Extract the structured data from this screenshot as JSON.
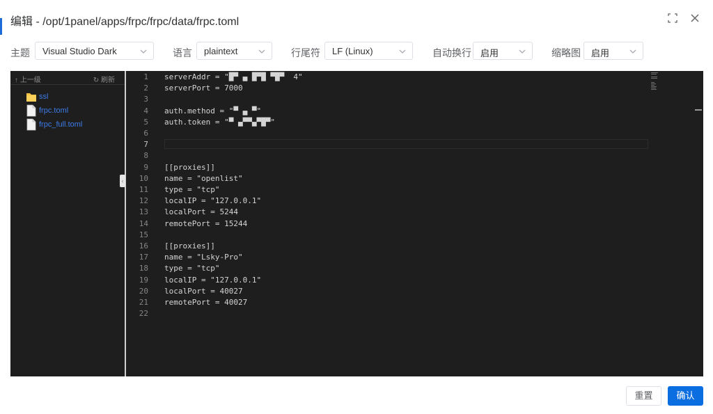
{
  "dialog": {
    "title": "编辑 - /opt/1panel/apps/frpc/frpc/data/frpc.toml"
  },
  "toolbar": {
    "theme": {
      "label": "主题",
      "value": "Visual Studio Dark"
    },
    "language": {
      "label": "语言",
      "value": "plaintext"
    },
    "eol": {
      "label": "行尾符",
      "value": "LF (Linux)"
    },
    "wrap": {
      "label": "自动换行",
      "value": "启用"
    },
    "minimap": {
      "label": "缩略图",
      "value": "启用"
    }
  },
  "filetree": {
    "up_label": "上一级",
    "refresh_label": "刷新",
    "items": [
      {
        "name": "ssl",
        "kind": "folder",
        "icon": "folder-icon"
      },
      {
        "name": "frpc.toml",
        "kind": "file",
        "icon": "file-icon"
      },
      {
        "name": "frpc_full.toml",
        "kind": "file",
        "icon": "file-icon"
      }
    ]
  },
  "editor": {
    "current_line": 7,
    "lines": [
      {
        "n": "1",
        "text": "serverAddr = \"█▀ ▄ █▀█ ▀█▀  4\""
      },
      {
        "n": "2",
        "text": "serverPort = 7000"
      },
      {
        "n": "3",
        "text": ""
      },
      {
        "n": "4",
        "text": "auth.method = \"▀ ▄ ▀\""
      },
      {
        "n": "5",
        "text": "auth.token = \"▀ ▄▀▀▄▀█▀\""
      },
      {
        "n": "6",
        "text": ""
      },
      {
        "n": "7",
        "text": ""
      },
      {
        "n": "8",
        "text": ""
      },
      {
        "n": "9",
        "text": "[[proxies]]"
      },
      {
        "n": "10",
        "text": "name = \"openlist\""
      },
      {
        "n": "11",
        "text": "type = \"tcp\""
      },
      {
        "n": "12",
        "text": "localIP = \"127.0.0.1\""
      },
      {
        "n": "13",
        "text": "localPort = 5244"
      },
      {
        "n": "14",
        "text": "remotePort = 15244"
      },
      {
        "n": "15",
        "text": ""
      },
      {
        "n": "16",
        "text": "[[proxies]]"
      },
      {
        "n": "17",
        "text": "name = \"Lsky-Pro\""
      },
      {
        "n": "18",
        "text": "type = \"tcp\""
      },
      {
        "n": "19",
        "text": "localIP = \"127.0.0.1\""
      },
      {
        "n": "20",
        "text": "localPort = 40027"
      },
      {
        "n": "21",
        "text": "remotePort = 40027"
      },
      {
        "n": "22",
        "text": ""
      }
    ]
  },
  "footer": {
    "reset_label": "重置",
    "confirm_label": "确认"
  },
  "colors": {
    "accent": "#0b6ee0",
    "editor_bg": "#1e1e1e",
    "file_link": "#3c7be8",
    "folder": "#f5c342"
  }
}
